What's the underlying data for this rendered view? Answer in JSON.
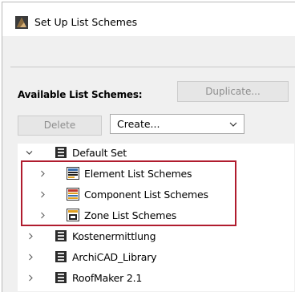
{
  "window": {
    "title": "Set Up List Schemes"
  },
  "available": {
    "label": "Available List Schemes:",
    "duplicate_label": "Duplicate...",
    "delete_label": "Delete",
    "create_value": "Create..."
  },
  "tree": {
    "items": [
      {
        "label": "Default Set",
        "expanded": true
      },
      {
        "label": "Element List Schemes"
      },
      {
        "label": "Component List Schemes"
      },
      {
        "label": "Zone List Schemes"
      },
      {
        "label": "Kostenermittlung"
      },
      {
        "label": "ArchiCAD_Library"
      },
      {
        "label": "RoofMaker 2.1"
      }
    ]
  },
  "colors": {
    "highlight": "#b01c2e"
  }
}
